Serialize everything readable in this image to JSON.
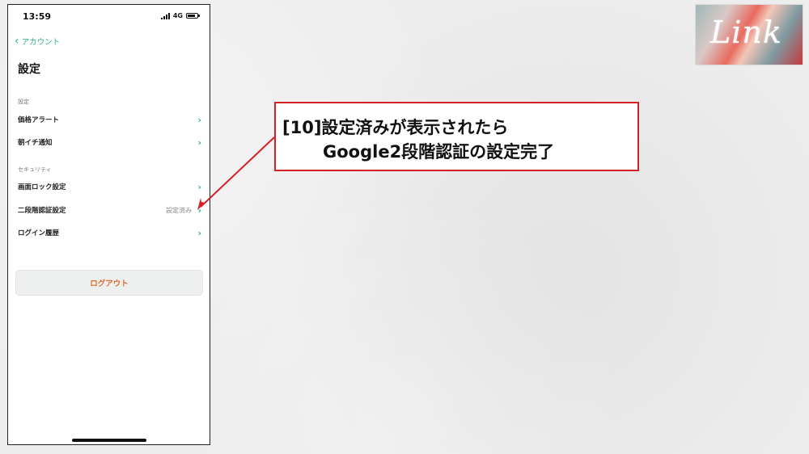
{
  "status_bar": {
    "time": "13:59",
    "network": "4G"
  },
  "nav": {
    "back_label": "アカウント"
  },
  "page": {
    "title": "設定"
  },
  "sections": [
    {
      "header": "設定",
      "rows": [
        {
          "label": "価格アラート",
          "value": ""
        },
        {
          "label": "朝イチ通知",
          "value": ""
        }
      ]
    },
    {
      "header": "セキュリティ",
      "rows": [
        {
          "label": "画面ロック設定",
          "value": ""
        },
        {
          "label": "二段階認証設定",
          "value": "設定済み"
        },
        {
          "label": "ログイン履歴",
          "value": ""
        }
      ]
    }
  ],
  "logout": {
    "label": "ログアウト"
  },
  "logo": {
    "text": "Link"
  },
  "annotation": {
    "line1": "[10]設定済みが表示されたら",
    "line2": "Google2段階認証の設定完了"
  },
  "colors": {
    "accent": "#2bb38a",
    "logout": "#e06a2c",
    "callout_border": "#d62027"
  }
}
